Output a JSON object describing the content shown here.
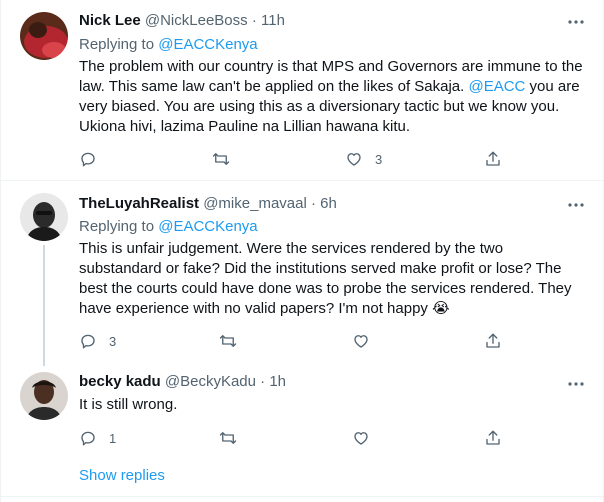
{
  "tweets": [
    {
      "name": "Nick Lee",
      "handle": "@NickLeeBoss",
      "dot": "·",
      "time": "11h",
      "replying_prefix": "Replying to ",
      "replying_to": "@EACCKenya",
      "text_1": "The problem with our country is that MPS and Governors are immune to the law. This same law can't be applied on the likes of Sakaja. ",
      "text_mention": "@EACC",
      "text_2": " you are very biased.  You are using this as a diversionary tactic but we know you. Ukiona hivi, lazima Pauline na Lillian hawana kitu.",
      "reply_count": "",
      "retweet_count": "",
      "like_count": "3"
    },
    {
      "name": "TheLuyahRealist",
      "handle": "@mike_mavaal",
      "dot": "·",
      "time": "6h",
      "replying_prefix": "Replying to ",
      "replying_to": "@EACCKenya",
      "text": "This is unfair judgement. Were the services rendered by the two substandard or fake? Did the institutions served make profit or lose? The best the courts could have done was to probe the services rendered. They have experience with no valid papers? I'm not happy ",
      "emoji": "😭",
      "reply_count": "3",
      "retweet_count": "",
      "like_count": ""
    },
    {
      "name": "becky kadu",
      "handle": "@BeckyKadu",
      "dot": "·",
      "time": "1h",
      "text": "It is still wrong.",
      "reply_count": "1",
      "retweet_count": "",
      "like_count": ""
    }
  ],
  "show_replies": "Show replies",
  "colors": {
    "accent": "#1d9bf0",
    "secondary": "#536471",
    "crying_emoji": "#ffcc4d"
  },
  "icons": [
    "reply-icon",
    "retweet-icon",
    "like-icon",
    "share-icon",
    "more-icon"
  ]
}
